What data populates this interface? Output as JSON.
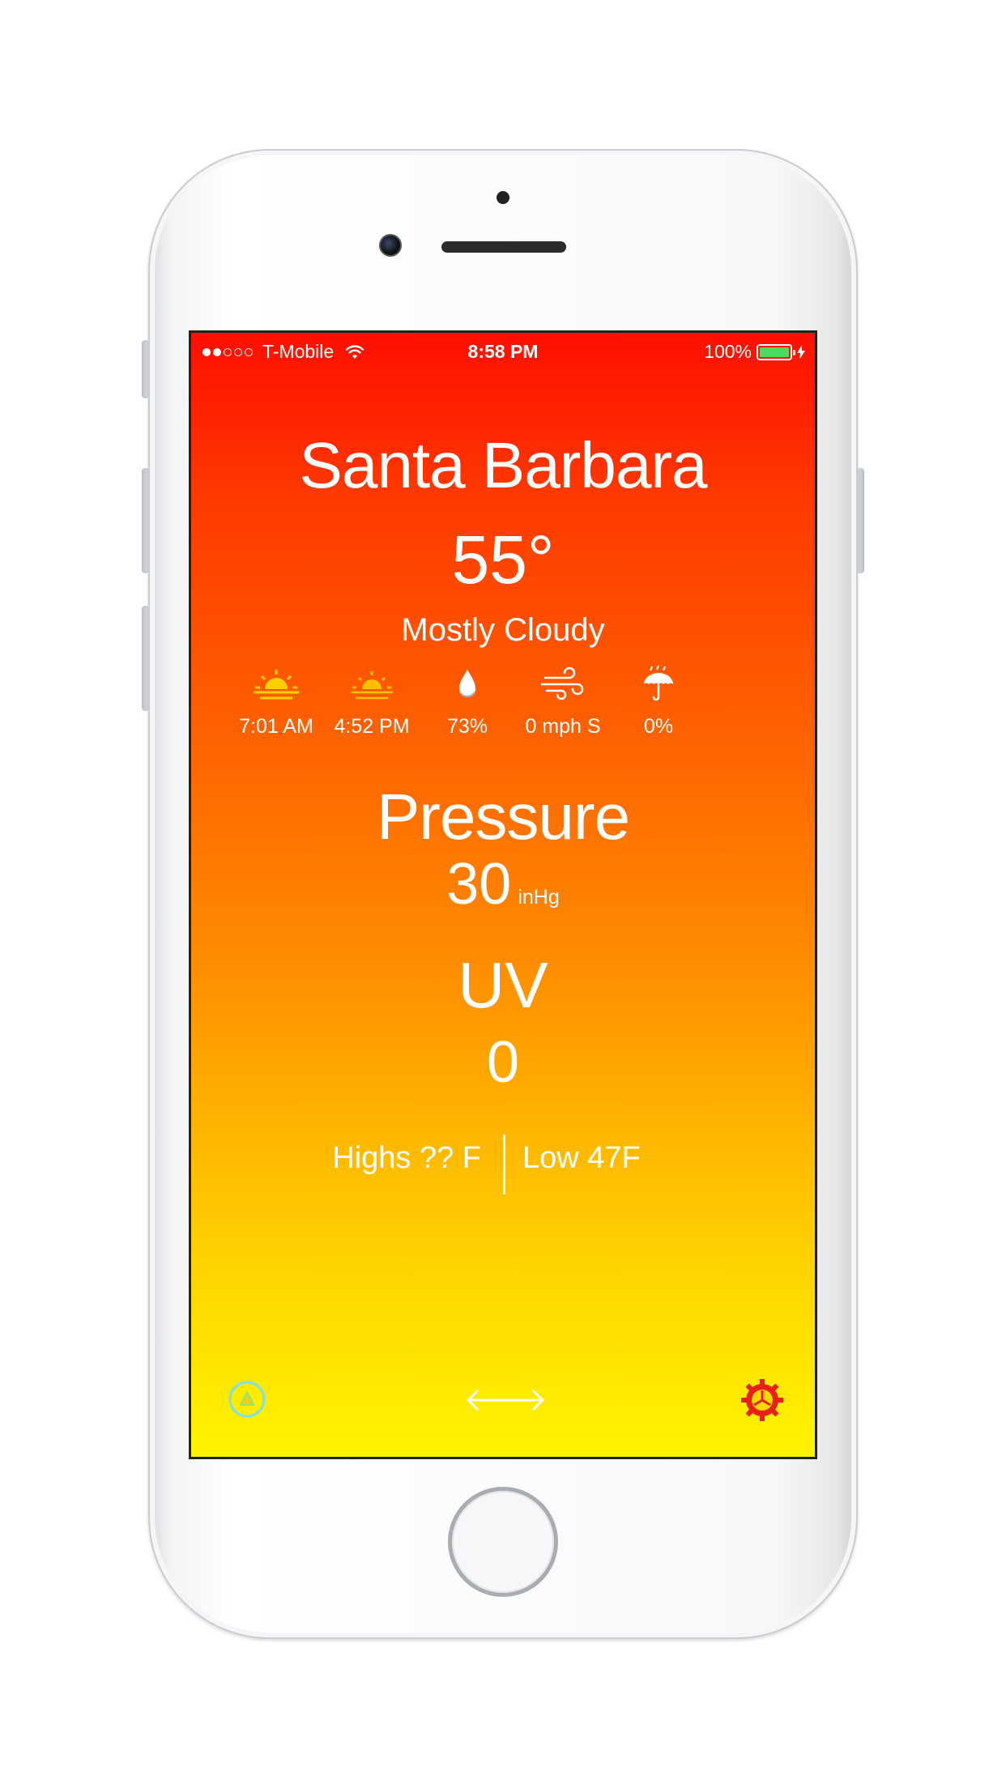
{
  "status_bar": {
    "carrier": "T-Mobile",
    "time": "8:58 PM",
    "battery": "100%",
    "battery_level": 1.0,
    "signal_bars_filled": 2,
    "signal_bars_total": 5,
    "icons": [
      "signal-icon",
      "wifi-icon",
      "battery-icon",
      "charging-bolt-icon"
    ]
  },
  "weather": {
    "city": "Santa Barbara",
    "temperature": "55°",
    "condition": "Mostly Cloudy",
    "metrics": [
      {
        "icon": "sunrise-icon",
        "label": "7:01 AM"
      },
      {
        "icon": "sunset-icon",
        "label": "4:52 PM"
      },
      {
        "icon": "humidity-drop-icon",
        "label": "73%"
      },
      {
        "icon": "wind-icon",
        "label": "0 mph S"
      },
      {
        "icon": "umbrella-icon",
        "label": "0%"
      }
    ],
    "pressure": {
      "title": "Pressure",
      "value": "30",
      "unit": "inHg"
    },
    "uv": {
      "title": "UV",
      "value": "0"
    },
    "high": "Highs ?? F",
    "low": "Low 47F"
  },
  "toolbar": {
    "icons": [
      "location-icon",
      "swap-arrows-icon",
      "settings-gear-icon"
    ]
  },
  "colors": {
    "gradient_top": "#ff0f00",
    "gradient_bottom": "#fff500",
    "sun_icon": "#ffd000",
    "settings_gear": "#e8201a",
    "location_ring": "#7ee0ea",
    "battery_fill": "#4cd964"
  }
}
